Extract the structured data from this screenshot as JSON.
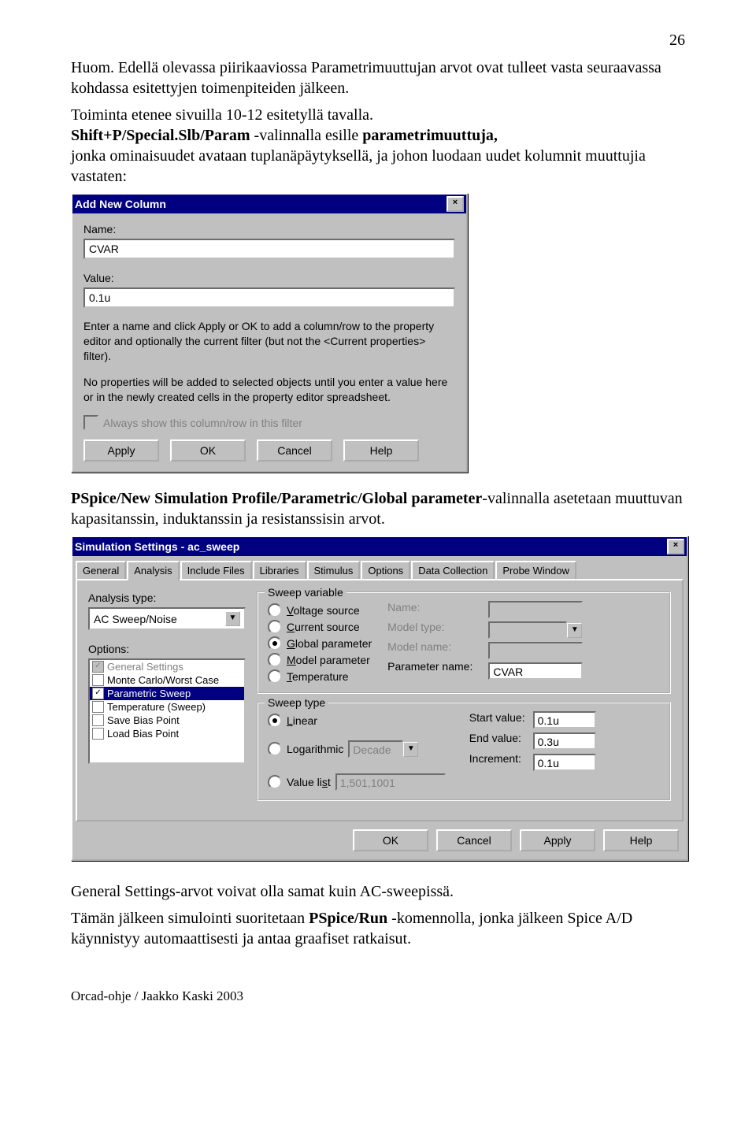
{
  "page_number": "26",
  "p1a": "Huom. Edellä olevassa piirikaaviossa Parametrimuuttujan arvot ovat tulleet vasta seuraavassa kohdassa esitettyjen toimenpiteiden jälkeen.",
  "p2a": "Toiminta etenee sivuilla 10-12 esitetyllä tavalla.",
  "p2b_bold": "Shift+P/Special.Slb/Param",
  "p2b": " -valinnalla esille ",
  "p2c_bold": "parametrimuuttuja,",
  "p2d": "jonka ominaisuudet avataan tuplanäpäytyksellä, ja johon luodaan uudet kolumnit muuttujia vastaten:",
  "dlg1": {
    "title": "Add New Column",
    "name_lbl": "Name:",
    "name_val": "CVAR",
    "value_lbl": "Value:",
    "value_val": "0.1u",
    "desc1": "Enter a name and click Apply or OK to add a column/row to the property editor and optionally the current filter (but not the <Current properties> filter).",
    "desc2": "No properties will be added to selected objects until you enter a value here or in the newly created cells in the property editor spreadsheet.",
    "cb_lbl": "Always show this column/row in this filter",
    "btn_apply": "Apply",
    "btn_ok": "OK",
    "btn_cancel": "Cancel",
    "btn_help": "Help"
  },
  "p3a_bold": "PSpice/New Simulation Profile/Parametric/Global parameter",
  "p3a": "-valinnalla asetetaan muuttuvan kapasitanssin, induktanssin ja resistanssisin arvot.",
  "dlg2": {
    "title": "Simulation Settings - ac_sweep",
    "tabs": [
      "General",
      "Analysis",
      "Include Files",
      "Libraries",
      "Stimulus",
      "Options",
      "Data Collection",
      "Probe Window"
    ],
    "atype_lbl": "Analysis type:",
    "atype_val": "AC Sweep/Noise",
    "opts_lbl": "Options:",
    "opts": [
      {
        "label": "General Settings",
        "checked": true,
        "disabled": true
      },
      {
        "label": "Monte Carlo/Worst Case",
        "checked": false
      },
      {
        "label": "Parametric Sweep",
        "checked": true,
        "selected": true
      },
      {
        "label": "Temperature (Sweep)",
        "checked": false
      },
      {
        "label": "Save Bias Point",
        "checked": false
      },
      {
        "label": "Load Bias Point",
        "checked": false
      }
    ],
    "sv_title": "Sweep variable",
    "sv_radios": [
      "Voltage source",
      "Current source",
      "Global parameter",
      "Model parameter",
      "Temperature"
    ],
    "sv_name": "Name:",
    "sv_mtype": "Model type:",
    "sv_mname": "Model name:",
    "sv_pname": "Parameter name:",
    "sv_pval": "CVAR",
    "st_title": "Sweep type",
    "st_linear": "Linear",
    "st_log": "Logarithmic",
    "st_decade": "Decade",
    "st_vlist": "Value list",
    "st_vlist_val": "1,501,1001",
    "st_start": "Start value:",
    "st_startv": "0.1u",
    "st_end": "End value:",
    "st_endv": "0.3u",
    "st_incr": "Increment:",
    "st_incrv": "0.1u",
    "b_ok": "OK",
    "b_cancel": "Cancel",
    "b_apply": "Apply",
    "b_help": "Help"
  },
  "p4": "General Settings-arvot voivat olla samat kuin AC-sweepissä.",
  "p5a": "Tämän jälkeen simulointi suoritetaan ",
  "p5b_bold": "PSpice/Run",
  "p5c": " -komennolla, jonka jälkeen Spice A/D käynnistyy automaattisesti ja antaa graafiset ratkaisut.",
  "footer": "Orcad-ohje / Jaakko Kaski 2003"
}
